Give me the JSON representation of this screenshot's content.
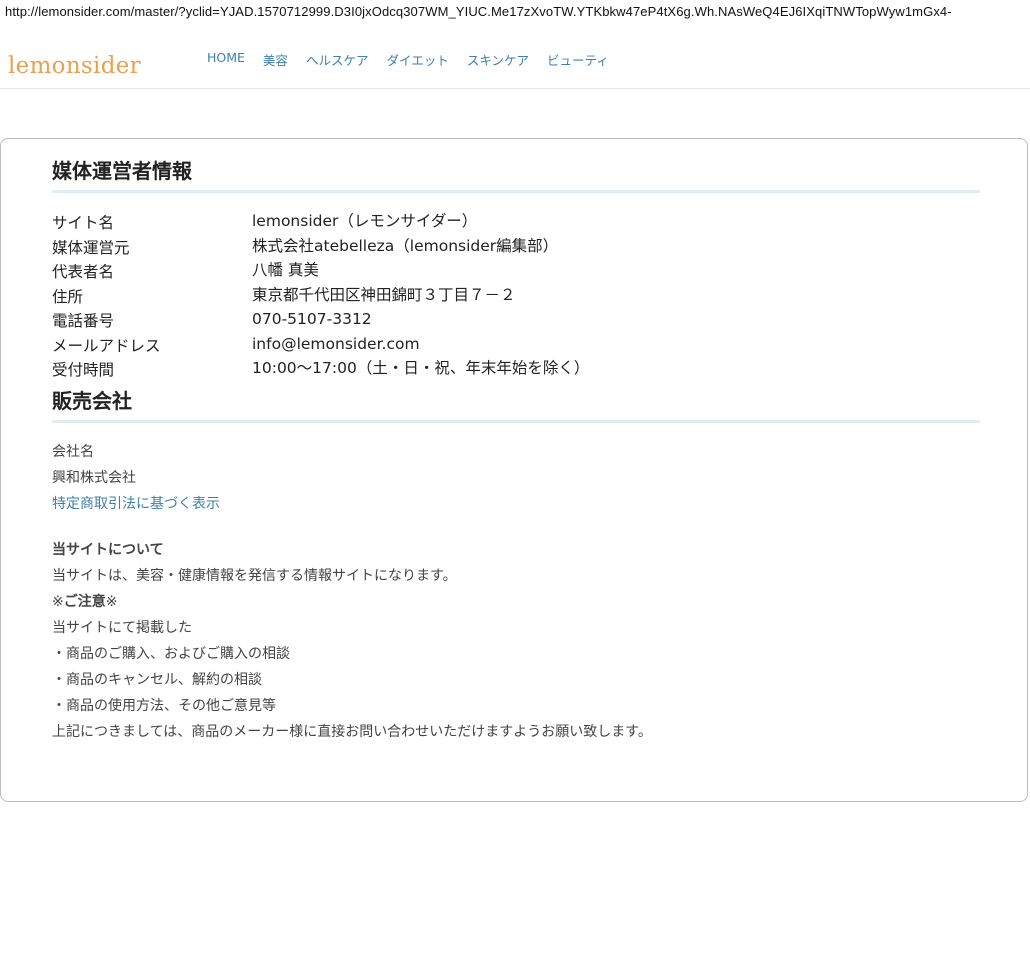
{
  "browser": {
    "url": "http://lemonsider.com/master/?yclid=YJAD.1570712999.D3I0jxOdcq307WM_YIUC.Me17zXvoTW.YTKbkw47eP4tX6g.Wh.NAsWeQ4EJ6IXqiTNWTopWyw1mGx4-"
  },
  "header": {
    "logo": "lemonsider",
    "nav": [
      "HOME",
      "美容",
      "ヘルスケア",
      "ダイエット",
      "スキンケア",
      "ビューティ"
    ]
  },
  "operator": {
    "title": "媒体運営者情報",
    "rows": [
      {
        "label": "サイト名",
        "value": "lemonsider（レモンサイダー）"
      },
      {
        "label": "媒体運営元",
        "value": "株式会社atebelleza（lemonsider編集部）"
      },
      {
        "label": "代表者名",
        "value": "八幡 真美"
      },
      {
        "label": "住所",
        "value": "東京都千代田区神田錦町３丁目７－２"
      },
      {
        "label": "電話番号",
        "value": "070-5107-3312"
      },
      {
        "label": "メールアドレス",
        "value": "info@lemonsider.com"
      },
      {
        "label": "受付時間",
        "value": "10:00～17:00（土・日・祝、年末年始を除く）"
      }
    ]
  },
  "seller": {
    "title": "販売会社",
    "company_label": "会社名",
    "company_name": "興和株式会社",
    "link_text": "特定商取引法に基づく表示"
  },
  "about": {
    "heading": "当サイトについて",
    "intro": "当サイトは、美容・健康情報を発信する情報サイトになります。",
    "caution_prefix": "※",
    "caution_bold": "ご注意",
    "caution_suffix": "※",
    "posted": "当サイトにて掲載した",
    "items": [
      "・商品のご購入、およびご購入の相談",
      "・商品のキャンセル、解約の相談",
      "・商品の使用方法、その他ご意見等"
    ],
    "closing": "上記につきましては、商品のメーカー様に直接お問い合わせいただけますようお願い致します。"
  }
}
